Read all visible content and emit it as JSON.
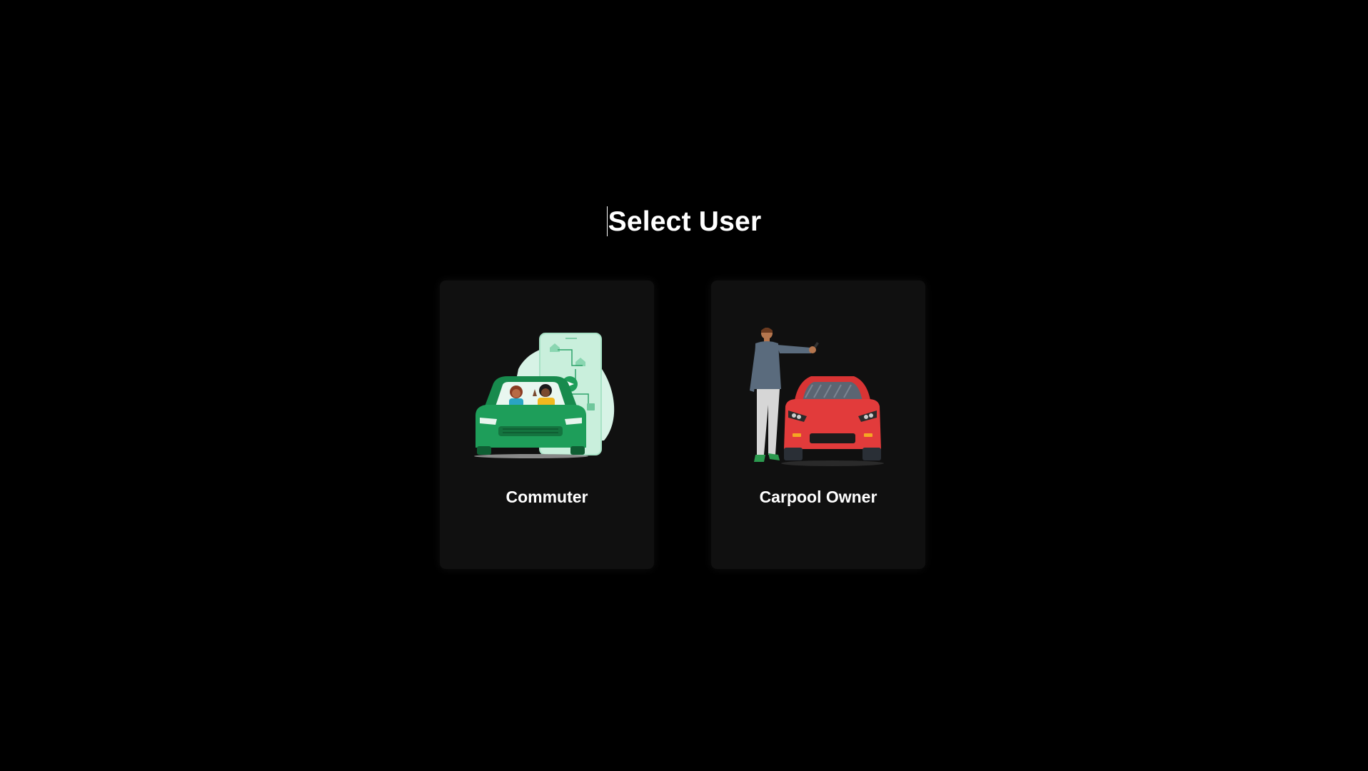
{
  "page": {
    "title": "Select User"
  },
  "cards": [
    {
      "label": "Commuter",
      "illustration": "commuter-car-illustration"
    },
    {
      "label": "Carpool Owner",
      "illustration": "owner-with-red-car-illustration"
    }
  ],
  "colors": {
    "background": "#000000",
    "card_background": "#101010",
    "text": "#ffffff",
    "commuter_car": "#1e9e5a",
    "owner_car": "#e23b3b"
  }
}
